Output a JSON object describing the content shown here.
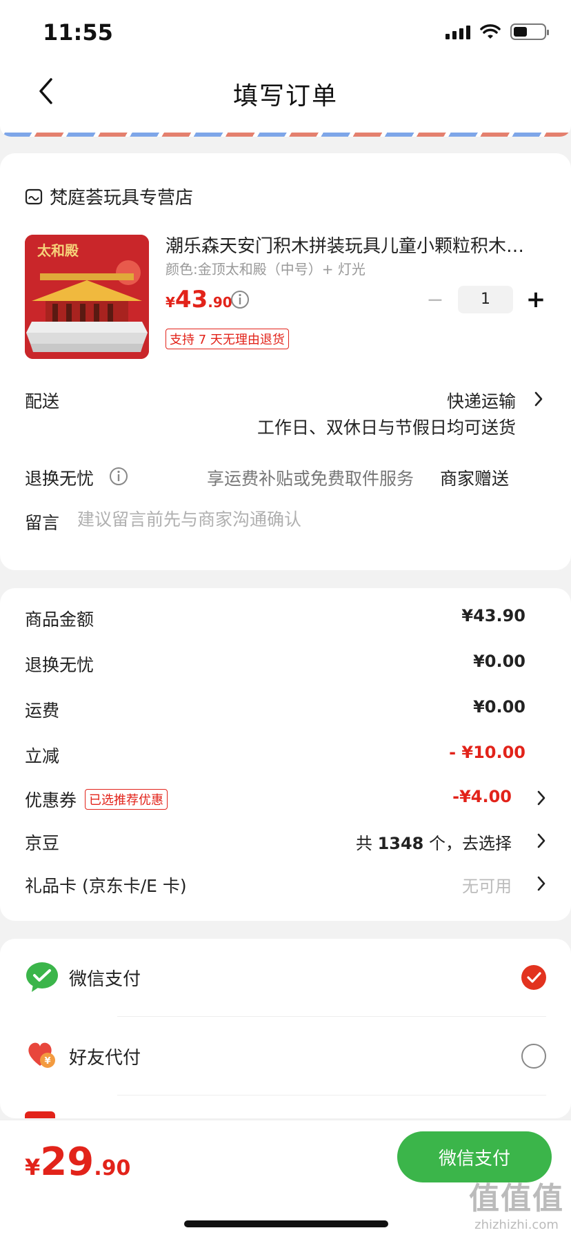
{
  "status_bar": {
    "time": "11:55"
  },
  "nav": {
    "title": "填写订单"
  },
  "store": {
    "name": "梵庭荟玩具专营店"
  },
  "product": {
    "title": "潮乐森天安门积木拼装玩具儿童小颗粒积木…",
    "spec": "颜色:金顶太和殿（中号）+ 灯光",
    "price_symbol": "¥",
    "price_int": "43",
    "price_dec": ".90",
    "quantity": "1",
    "return_badge": "支持 7 天无理由退货",
    "image_caption": "太和殿"
  },
  "delivery": {
    "label": "配送",
    "method": "快递运输",
    "note": "工作日、双休日与节假日均可送货"
  },
  "return_worry": {
    "label": "退换无忧",
    "subtitle": "享运费补贴或免费取件服务",
    "value": "商家赠送"
  },
  "message": {
    "label": "留言",
    "placeholder": "建议留言前先与商家沟通确认"
  },
  "amounts": [
    {
      "label": "商品金额",
      "value": "¥43.90"
    },
    {
      "label": "退换无忧",
      "value": "¥0.00"
    },
    {
      "label": "运费",
      "value": "¥0.00"
    },
    {
      "label": "立减",
      "value": "- ¥10.00"
    },
    {
      "label": "优惠券",
      "badge": "已选推荐优惠",
      "value": "-¥4.00"
    },
    {
      "label": "京豆",
      "value_prefix": "共 ",
      "value_num": "1348",
      "value_suffix": " 个，去选择"
    },
    {
      "label": "礼品卡 (京东卡/E 卡)",
      "value": "无可用"
    }
  ],
  "payment": {
    "options": [
      {
        "name": "微信支付",
        "selected": true
      },
      {
        "name": "好友代付",
        "selected": false
      }
    ]
  },
  "footer": {
    "total_symbol": "¥",
    "total_int": "29",
    "total_dec": ".90",
    "pay_button": "微信支付"
  },
  "watermark": {
    "main": "值值值",
    "sub": "zhizhizhi.com"
  },
  "colors": {
    "accent_red": "#e2231a",
    "wechat_green": "#3bb54a"
  }
}
